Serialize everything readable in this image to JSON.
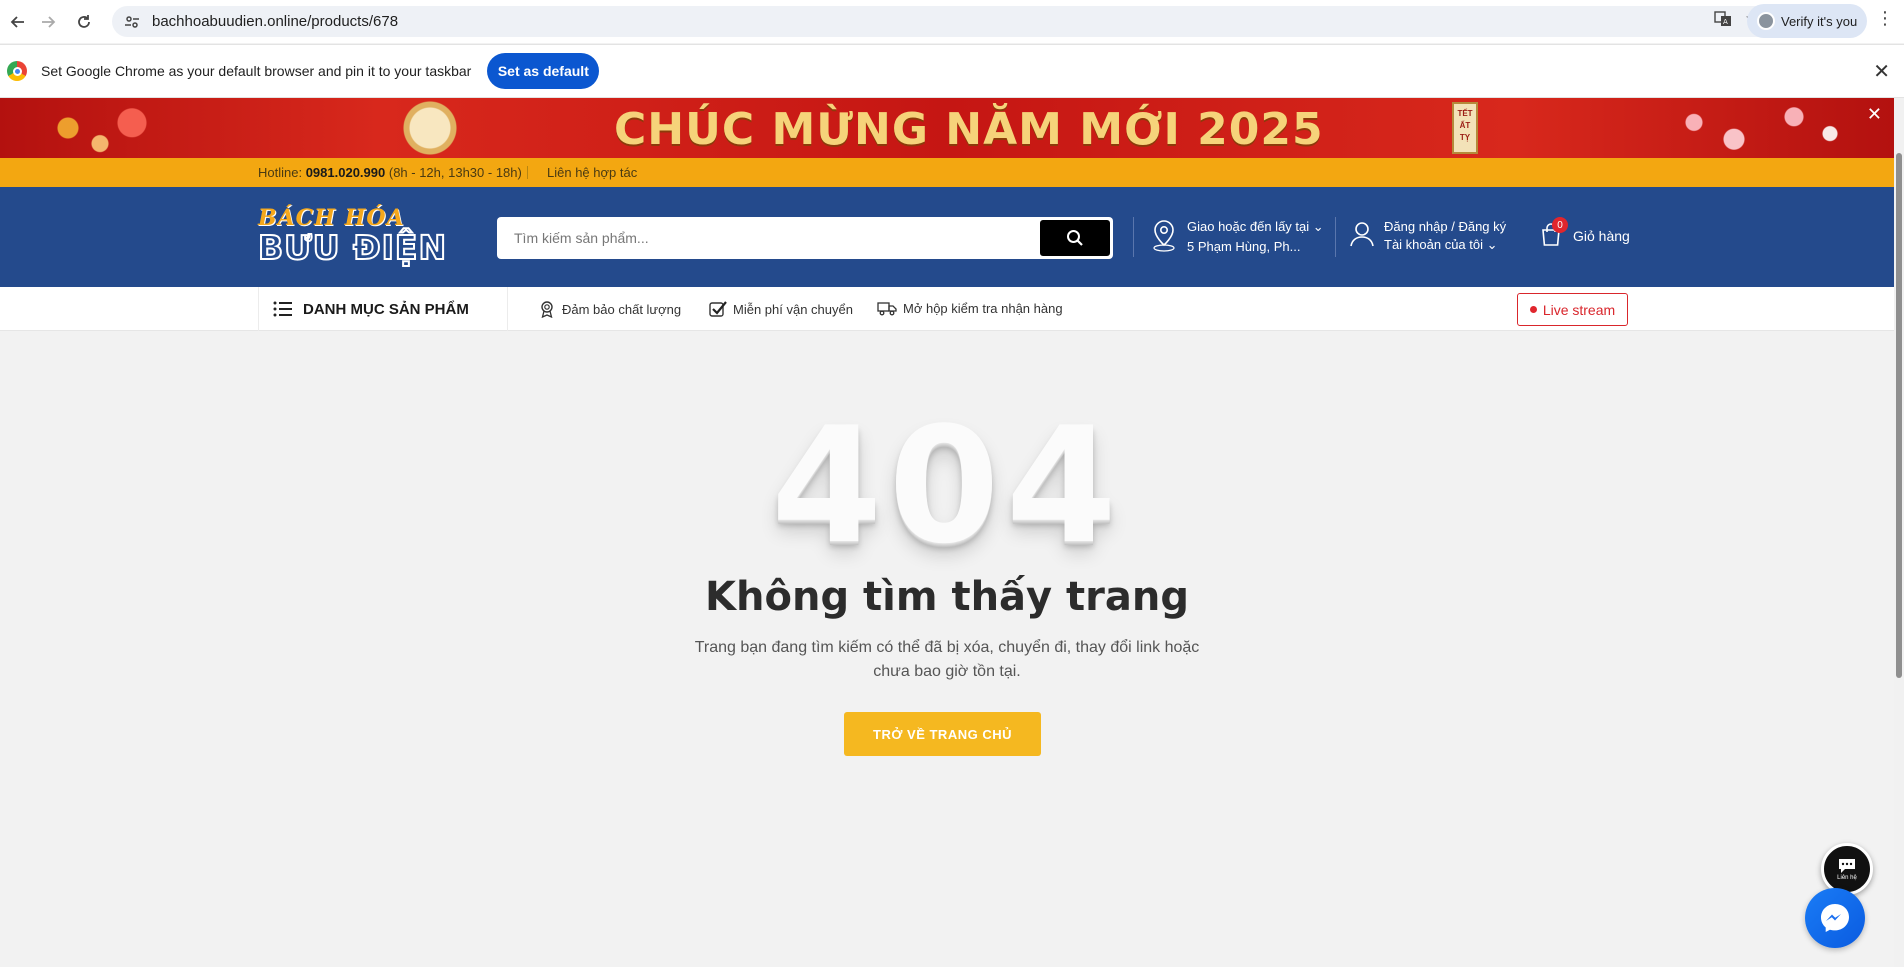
{
  "browser": {
    "url": "bachhoabuudien.online/products/678",
    "verify_label": "Verify it's you",
    "infobar_message": "Set Google Chrome as your default browser and pin it to your taskbar",
    "set_default_label": "Set as default"
  },
  "banner": {
    "title": "CHÚC MỪNG NĂM MỚI 2025",
    "tag_text": "TẾT ẤT TỴ"
  },
  "topbar": {
    "hotline_label": "Hotline:",
    "hotline_number": "0981.020.990",
    "hotline_hours": "(8h - 12h, 13h30 - 18h)",
    "contact_link": "Liên hệ hợp tác"
  },
  "header": {
    "logo_line1": "BÁCH HÓA",
    "logo_line2": "BƯU ĐIỆN",
    "search_placeholder": "Tìm kiếm sản phẩm...",
    "location_line1": "Giao hoặc đến lấy tại",
    "location_line2": "5 Phạm Hùng, Ph...",
    "account_line1": "Đăng nhập / Đăng ký",
    "account_line2": "Tài khoản của tôi",
    "cart_count": "0",
    "cart_label": "Giỏ hàng"
  },
  "nav": {
    "category_label": "DANH MỤC SẢN PHẨM",
    "features": [
      "Đảm bảo chất lượng",
      "Miễn phí vận chuyển",
      "Mở hộp kiểm tra nhận hàng"
    ],
    "live_label": "Live stream"
  },
  "error": {
    "code": "404",
    "title": "Không tìm thấy trang",
    "description": "Trang bạn đang tìm kiếm có thể đã bị xóa, chuyển đi, thay đổi link hoặc chưa bao giờ tồn tại.",
    "home_button": "TRỞ VỀ TRANG CHỦ"
  },
  "floating": {
    "chat_label": "Liên hệ"
  },
  "colors": {
    "header_blue": "#244a8c",
    "topbar_orange": "#f3a711",
    "banner_red": "#c51613",
    "home_button": "#f5b820",
    "live_red": "#d9262c",
    "chrome_blue": "#0b57d0"
  }
}
